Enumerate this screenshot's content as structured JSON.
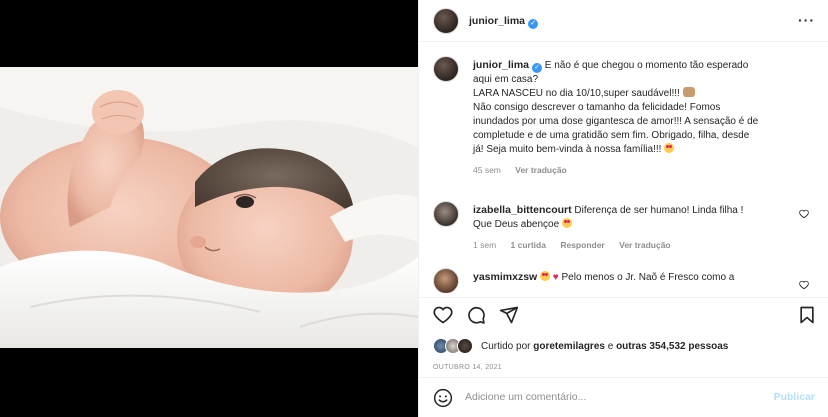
{
  "post": {
    "username": "junior_lima",
    "verified_icon": "verified-badge-icon",
    "more_icon": "more-options-icon",
    "caption": {
      "username": "junior_lima",
      "line1": "E não é que chegou o momento tão esperado",
      "line2": "aqui em casa?",
      "line3": "LARA NASCEU no dia 10/10,super saudável!!! ",
      "line4": "Não consigo descrever o tamanho da felicidade! Fomos",
      "line5": "inundados por uma dose gigantesca de amor!!! A sensação é de",
      "line6": "completude e de uma gratidão sem fim. Obrigado, filha, desde",
      "line7": "já! Seja muito bem-vinda à nossa família!!! ",
      "time": "45 sem",
      "translate": "Ver tradução"
    },
    "comments": [
      {
        "username": "izabella_bittencourt",
        "line1": "Diferença de ser humano! Linda filha !",
        "line2": "Que Deus abençoe ",
        "time": "1 sem",
        "likes": "1 curtida",
        "reply": "Responder",
        "translate": "Ver tradução"
      },
      {
        "username": "yasmimxzsw",
        "text": "Pelo menos o Jr. Naõ é Fresco como a"
      }
    ],
    "liked_by": {
      "prefix": "Curtido por",
      "user": "goretemilagres",
      "middle": "e",
      "others": "outras 354,532 pessoas"
    },
    "date": "OUTUBRO 14, 2021",
    "add_comment_placeholder": "Adicione um comentário...",
    "publish_label": "Publicar"
  },
  "colors": {
    "accent": "#3897f0",
    "publish_disabled": "#b2dffc",
    "muted": "#8e8e8e",
    "like_red": "#e0245e"
  }
}
